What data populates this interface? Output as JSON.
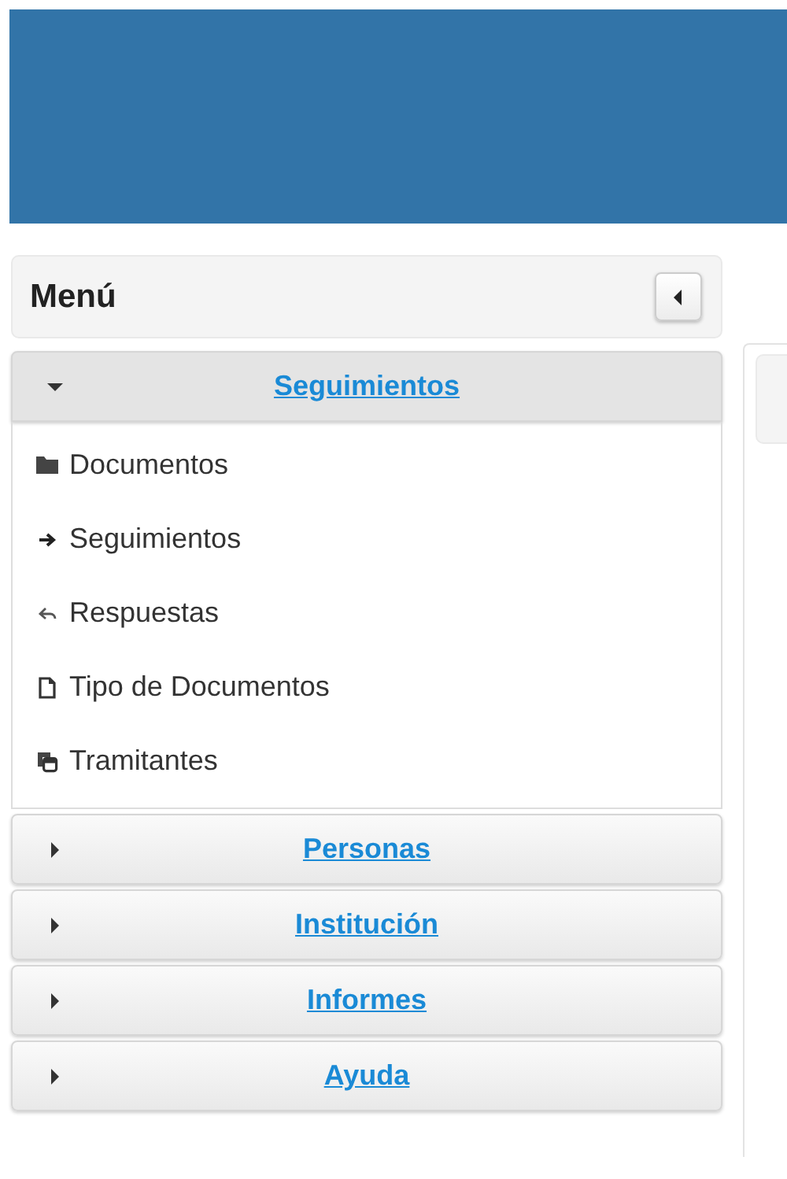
{
  "menu": {
    "title": "Menú"
  },
  "sections": [
    {
      "label": "Seguimientos",
      "expanded": true,
      "items": [
        {
          "label": "Documentos"
        },
        {
          "label": "Seguimientos"
        },
        {
          "label": "Respuestas"
        },
        {
          "label": "Tipo de Documentos"
        },
        {
          "label": "Tramitantes"
        }
      ]
    },
    {
      "label": "Personas",
      "expanded": false
    },
    {
      "label": "Institución",
      "expanded": false
    },
    {
      "label": "Informes",
      "expanded": false
    },
    {
      "label": "Ayuda",
      "expanded": false
    }
  ]
}
